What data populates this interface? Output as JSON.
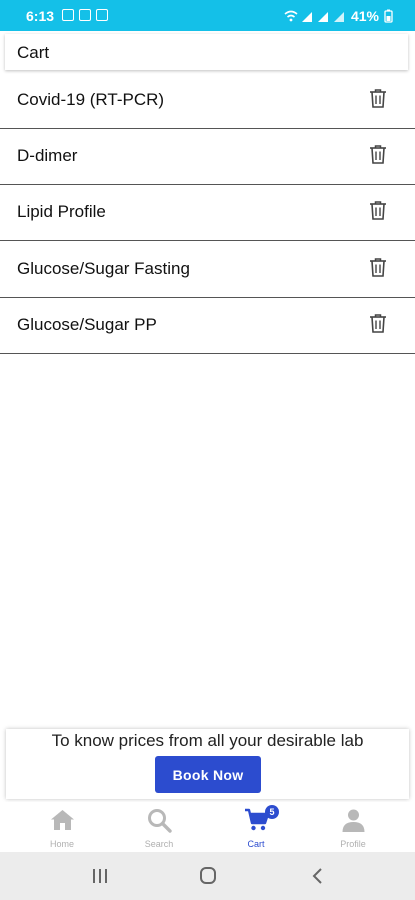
{
  "status_bar": {
    "time": "6:13",
    "battery": "41%",
    "signal_icon": "wifi-signal-icon",
    "accent": "#14c0e8"
  },
  "header": {
    "title": "Cart"
  },
  "cart_items": [
    {
      "name": "Covid-19 (RT-PCR)",
      "action_icon": "trash-icon"
    },
    {
      "name": "D-dimer",
      "action_icon": "trash-icon"
    },
    {
      "name": "Lipid Profile",
      "action_icon": "trash-icon"
    },
    {
      "name": "Glucose/Sugar Fasting",
      "action_icon": "trash-icon"
    },
    {
      "name": "Glucose/Sugar PP",
      "action_icon": "trash-icon"
    }
  ],
  "booking": {
    "message": "To know prices from all your desirable lab",
    "button_label": "Book Now",
    "button_color": "#2c4ccf"
  },
  "bottom_nav": {
    "active": "Cart",
    "cart_badge": "5",
    "items": [
      {
        "label": "Home",
        "icon": "home-icon"
      },
      {
        "label": "Search",
        "icon": "search-icon"
      },
      {
        "label": "Cart",
        "icon": "cart-icon"
      },
      {
        "label": "Profile",
        "icon": "profile-icon"
      }
    ]
  },
  "system_nav": {
    "buttons": [
      "recents-icon",
      "home-circle-icon",
      "back-icon"
    ]
  }
}
